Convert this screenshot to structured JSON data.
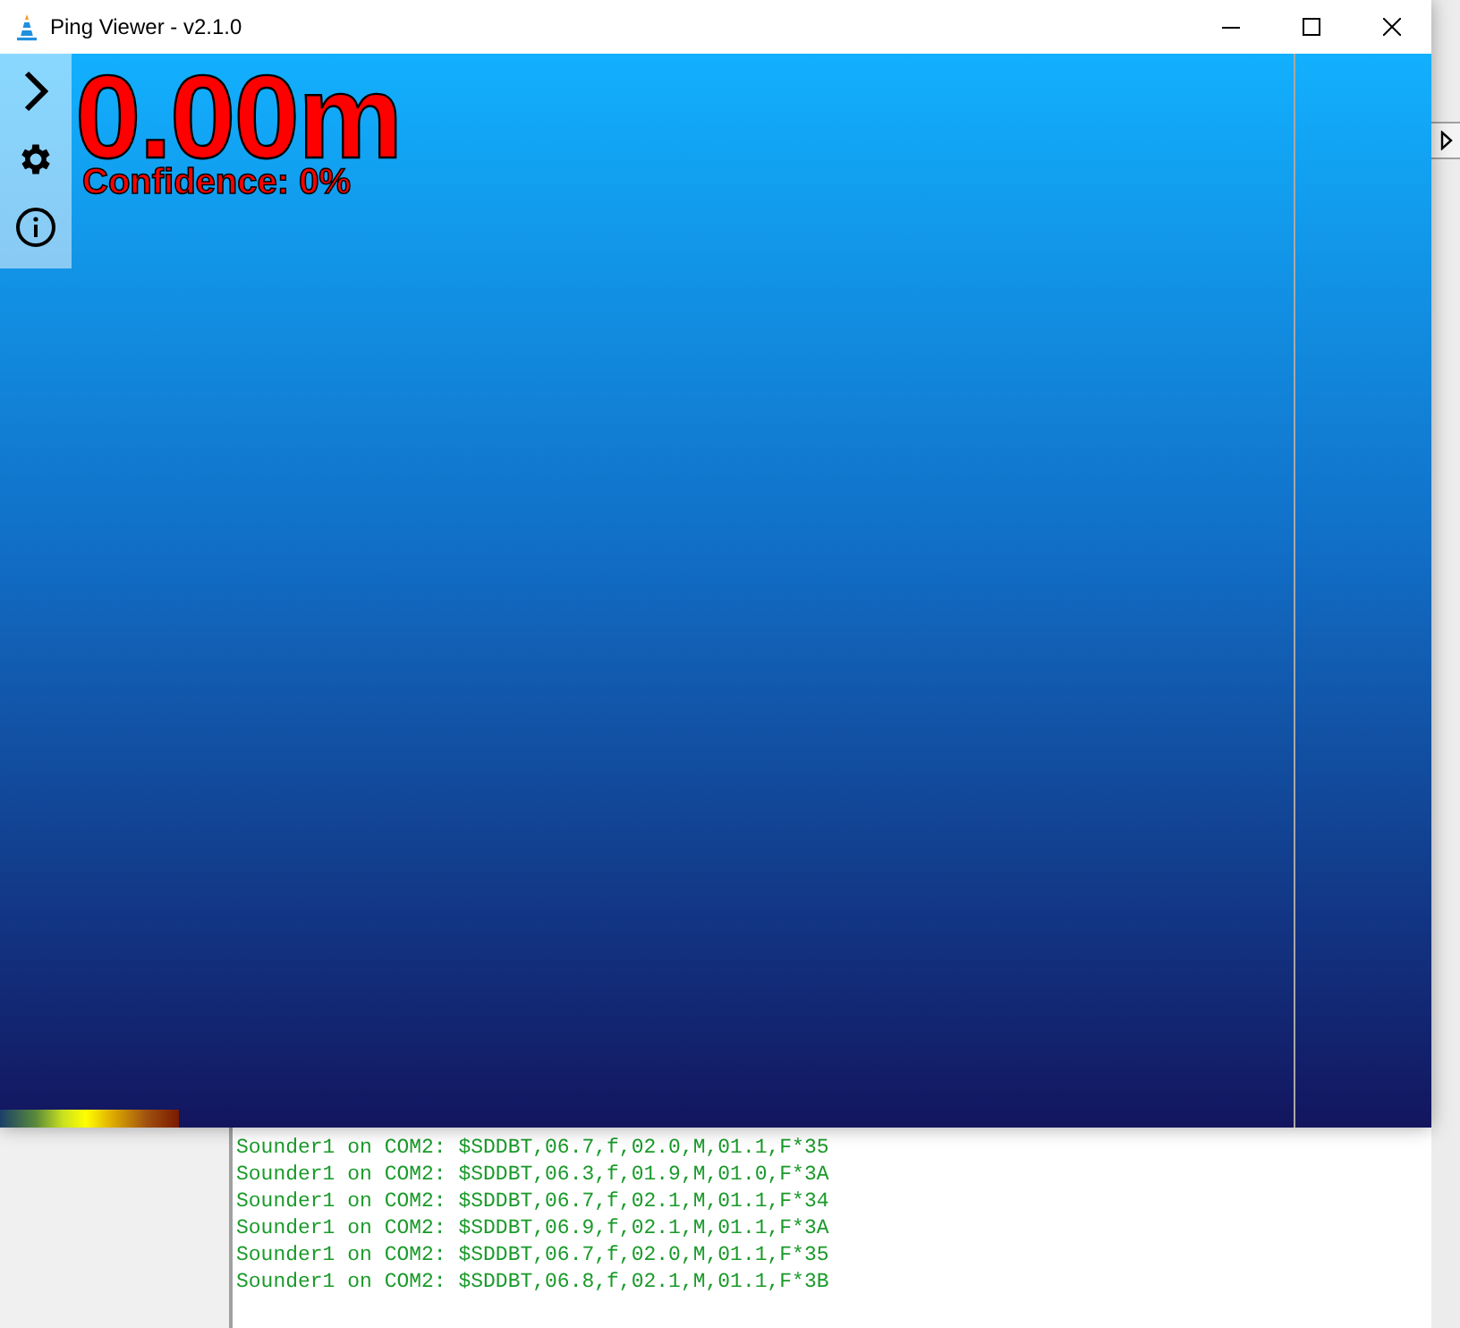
{
  "window": {
    "title": "Ping Viewer - v2.1.0"
  },
  "readout": {
    "depth": "0.00m",
    "confidence": "Confidence: 0%"
  },
  "log": {
    "lines": [
      "Sounder1 on COM2: $SDDBT,06.7,f,02.0,M,01.1,F*35",
      "Sounder1 on COM2: $SDDBT,06.3,f,01.9,M,01.0,F*3A",
      "Sounder1 on COM2: $SDDBT,06.7,f,02.1,M,01.1,F*34",
      "Sounder1 on COM2: $SDDBT,06.9,f,02.1,M,01.1,F*3A",
      "Sounder1 on COM2: $SDDBT,06.7,f,02.0,M,01.1,F*35",
      "Sounder1 on COM2: $SDDBT,06.8,f,02.1,M,01.1,F*3B"
    ]
  }
}
